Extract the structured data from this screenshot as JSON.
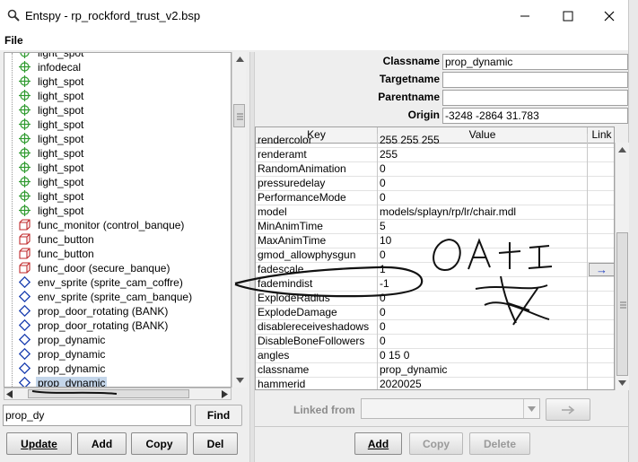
{
  "window": {
    "title": "Entspy - rp_rockford_trust_v2.bsp",
    "minimize": "—",
    "maximize": "☐",
    "close": "✕"
  },
  "menu": {
    "file": "File"
  },
  "tree": {
    "items": [
      {
        "label": "light_spot",
        "icon": "light-icon"
      },
      {
        "label": "infodecal",
        "icon": "light-icon"
      },
      {
        "label": "light_spot",
        "icon": "light-icon"
      },
      {
        "label": "light_spot",
        "icon": "light-icon"
      },
      {
        "label": "light_spot",
        "icon": "light-icon"
      },
      {
        "label": "light_spot",
        "icon": "light-icon"
      },
      {
        "label": "light_spot",
        "icon": "light-icon"
      },
      {
        "label": "light_spot",
        "icon": "light-icon"
      },
      {
        "label": "light_spot",
        "icon": "light-icon"
      },
      {
        "label": "light_spot",
        "icon": "light-icon"
      },
      {
        "label": "light_spot",
        "icon": "light-icon"
      },
      {
        "label": "light_spot",
        "icon": "light-icon"
      },
      {
        "label": "func_monitor (control_banque)",
        "icon": "brush-icon"
      },
      {
        "label": "func_button",
        "icon": "brush-icon"
      },
      {
        "label": "func_button",
        "icon": "brush-icon"
      },
      {
        "label": "func_door (secure_banque)",
        "icon": "brush-icon"
      },
      {
        "label": "env_sprite (sprite_cam_coffre)",
        "icon": "point-icon"
      },
      {
        "label": "env_sprite (sprite_cam_banque)",
        "icon": "point-icon"
      },
      {
        "label": "prop_door_rotating (BANK)",
        "icon": "point-icon"
      },
      {
        "label": "prop_door_rotating (BANK)",
        "icon": "point-icon"
      },
      {
        "label": "prop_dynamic",
        "icon": "point-icon"
      },
      {
        "label": "prop_dynamic",
        "icon": "point-icon"
      },
      {
        "label": "prop_dynamic",
        "icon": "point-icon"
      },
      {
        "label": "prop_dynamic",
        "icon": "point-icon",
        "selected": true
      }
    ]
  },
  "search": {
    "value": "prop_dy",
    "find_label": "Find"
  },
  "buttons": {
    "update": "Update",
    "add": "Add",
    "copy": "Copy",
    "del": "Del"
  },
  "props": {
    "classname_label": "Classname",
    "classname_value": "prop_dynamic",
    "targetname_label": "Targetname",
    "targetname_value": "",
    "parentname_label": "Parentname",
    "parentname_value": "",
    "origin_label": "Origin",
    "origin_value": "-3248 -2864 31.783"
  },
  "table": {
    "headers": [
      "Key",
      "Value",
      "Link"
    ],
    "rows": [
      {
        "key": "rendercolor",
        "value": "255 255 255"
      },
      {
        "key": "renderamt",
        "value": "255"
      },
      {
        "key": "RandomAnimation",
        "value": "0"
      },
      {
        "key": "pressuredelay",
        "value": "0"
      },
      {
        "key": "PerformanceMode",
        "value": "0"
      },
      {
        "key": "model",
        "value": "models/splayn/rp/lr/chair.mdl"
      },
      {
        "key": "MinAnimTime",
        "value": "5"
      },
      {
        "key": "MaxAnimTime",
        "value": "10"
      },
      {
        "key": "gmod_allowphysgun",
        "value": "0"
      },
      {
        "key": "fadescale",
        "value": "1",
        "link": "→"
      },
      {
        "key": "fademindist",
        "value": "-1"
      },
      {
        "key": "ExplodeRadius",
        "value": "0"
      },
      {
        "key": "ExplodeDamage",
        "value": "0"
      },
      {
        "key": "disablereceiveshadows",
        "value": "0"
      },
      {
        "key": "DisableBoneFollowers",
        "value": "0"
      },
      {
        "key": "angles",
        "value": "0 15 0"
      },
      {
        "key": "classname",
        "value": "prop_dynamic"
      },
      {
        "key": "hammerid",
        "value": "2020025"
      }
    ]
  },
  "linked": {
    "label": "Linked from",
    "value": "",
    "go": "→"
  },
  "table_buttons": {
    "add": "Add",
    "copy": "Copy",
    "delete": "Delete"
  },
  "annotation": {
    "text": "OAT I"
  },
  "colors": {
    "accent": "#1f3fbf",
    "selection": "#c4d6ea",
    "light_icon": "#2e9a2e",
    "brush_icon": "#c0282a",
    "point_icon": "#1b3fb0"
  }
}
